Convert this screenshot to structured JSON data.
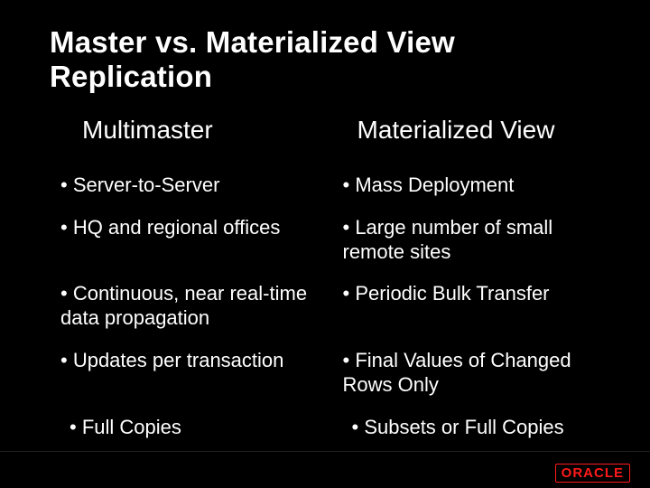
{
  "title": "Master vs. Materialized View Replication",
  "headers": {
    "left": "Multimaster",
    "right": "Materialized View"
  },
  "rows": [
    {
      "left": "• Server-to-Server",
      "right": "• Mass Deployment"
    },
    {
      "left": "• HQ and regional offices",
      "right": "• Large number of small remote sites"
    },
    {
      "left": "• Continuous, near real-time data propagation",
      "right": "• Periodic Bulk Transfer"
    },
    {
      "left": "• Updates per transaction",
      "right": "• Final Values of Changed Rows Only"
    },
    {
      "left": "• Full Copies",
      "right": "• Subsets or Full Copies",
      "indent": true
    }
  ],
  "logo": "ORACLE"
}
